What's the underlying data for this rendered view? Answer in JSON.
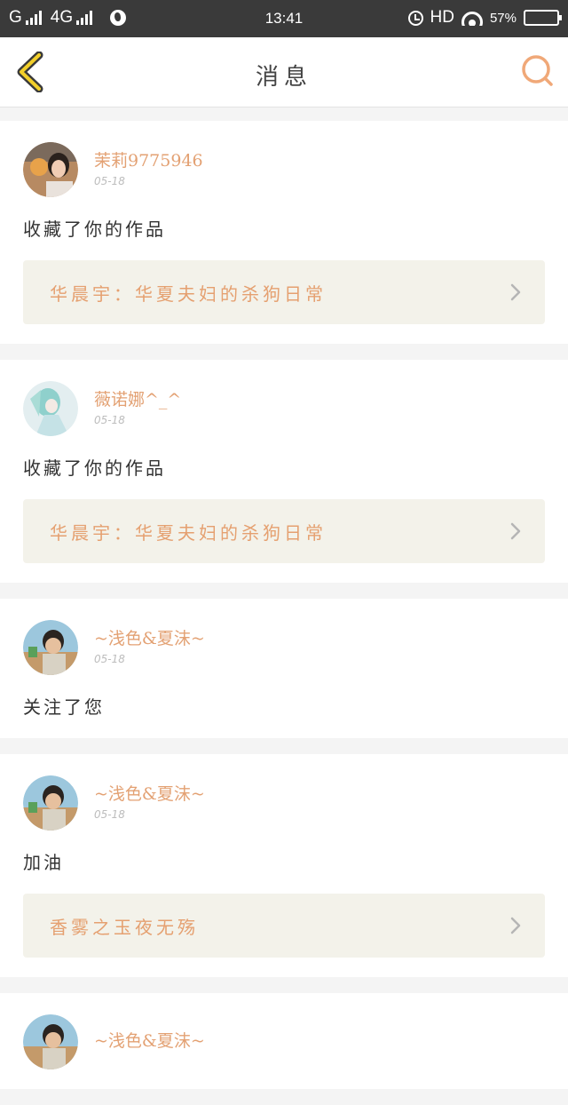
{
  "status_bar": {
    "carrier1": "G",
    "carrier2": "4G",
    "time": "13:41",
    "hd": "HD",
    "battery_pct": "57%",
    "battery_level": 0.57
  },
  "header": {
    "title": "消息",
    "back_icon": "chevron-left-icon",
    "search_icon": "search-icon"
  },
  "accent_color": "#e3a173",
  "messages": [
    {
      "user": "茉莉9775946",
      "date": "05-18",
      "action": "收藏了你的作品",
      "work": "华晨宇：华夏夫妇的杀狗日常"
    },
    {
      "user": "薇诺娜^_^",
      "date": "05-18",
      "action": "收藏了你的作品",
      "work": "华晨宇：华夏夫妇的杀狗日常"
    },
    {
      "user": "~浅色&夏沫~",
      "date": "05-18",
      "action": "关注了您"
    },
    {
      "user": "~浅色&夏沫~",
      "date": "05-18",
      "action": "加油",
      "work": "香雾之玉夜无殇"
    },
    {
      "user": "~浅色&夏沫~"
    }
  ]
}
